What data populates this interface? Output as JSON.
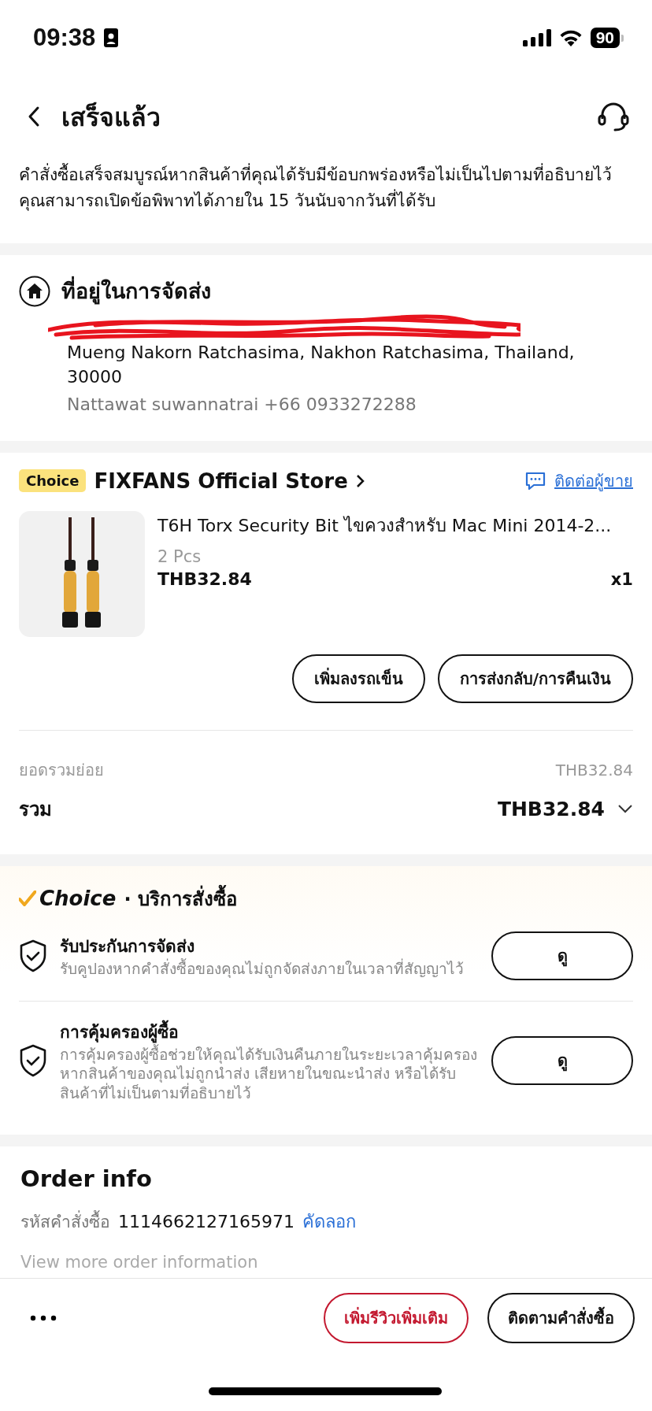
{
  "status_bar": {
    "time": "09:38",
    "battery": "90"
  },
  "header": {
    "title": "เสร็จแล้ว"
  },
  "notice": "คำสั่งซื้อเสร็จสมบูรณ์หากสินค้าที่คุณได้รับมีข้อบกพร่องหรือไม่เป็นไปตามที่อธิบายไว้คุณสามารถเปิดข้อพิพาทได้ภายใน 15 วันนับจากวันที่ได้รับ",
  "address": {
    "title": "ที่อยู่ในการจัดส่ง",
    "text": "Mueng Nakorn Ratchasima, Nakhon Ratchasima, Thailand, 30000",
    "contact": "Nattawat suwannatrai +66 0933272288"
  },
  "store": {
    "badge": "Choice",
    "name": "FIXFANS Official Store",
    "contact": "ติดต่อผู้ขาย"
  },
  "item": {
    "title": "T6H Torx Security Bit ไขควงสำหรับ Mac Mini 2014-2...",
    "variant": "2 Pcs",
    "price": "THB32.84",
    "quantity": "x1"
  },
  "item_actions": [
    "เพิ่มลงรถเข็น",
    "การส่งกลับ/การคืนเงิน"
  ],
  "summary": {
    "subtotal_label": "ยอดรวมย่อย",
    "subtotal": "THB32.84",
    "total_label": "รวม",
    "total": "THB32.84"
  },
  "services": {
    "brand": "Choice",
    "title": "· บริการสั่งซื้อ",
    "items": [
      {
        "title": "รับประกันการจัดส่ง",
        "description": "รับคูปองหากคำสั่งซื้อของคุณไม่ถูกจัดส่งภายในเวลาที่สัญญาไว้",
        "button": "ดู"
      },
      {
        "title": "การคุ้มครองผู้ซื้อ",
        "description": "การคุ้มครองผู้ซื้อช่วยให้คุณได้รับเงินคืนภายในระยะเวลาคุ้มครองหากสินค้าของคุณไม่ถูกนำส่ง เสียหายในขณะนำส่ง หรือได้รับสินค้าที่ไม่เป็นตามที่อธิบายไว้",
        "button": "ดู"
      }
    ]
  },
  "order_info": {
    "title": "Order info",
    "id_label": "รหัสคำสั่งซื้อ",
    "id": "1114662127165971",
    "copy": "คัดลอก",
    "more": "View more order information"
  },
  "bottom_bar": {
    "buttons": [
      {
        "label": "เพิ่มรีวิวเพิ่มเติม",
        "kind": "primary"
      },
      {
        "label": "ติดตามคำสั่งซื้อ",
        "kind": "secondary"
      }
    ]
  }
}
